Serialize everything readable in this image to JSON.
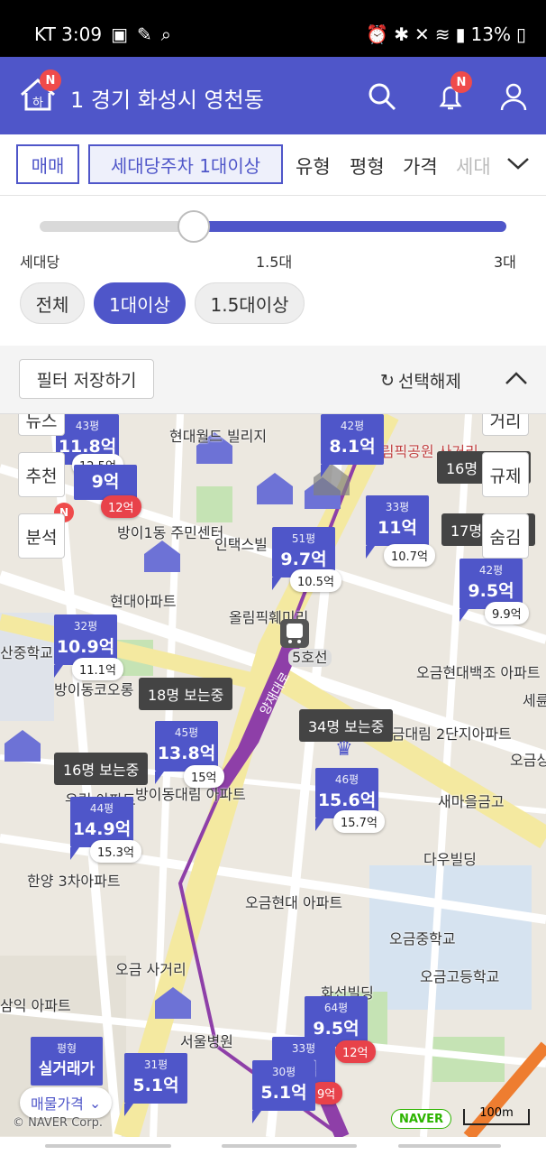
{
  "status": {
    "carrier_time": "KT 3:09",
    "battery": "13%"
  },
  "header": {
    "badge_home": "N",
    "location": "1  경기 화성시 영천동",
    "badge_bell": "N"
  },
  "filters": {
    "deal_type": "매매",
    "parking": "세대당주차 1대이상",
    "type": "유형",
    "size": "평형",
    "price": "가격",
    "more": "세대"
  },
  "slider": {
    "min_label": "세대당",
    "mid_label": "1.5대",
    "max_label": "3대",
    "value_fraction": 0.33,
    "options": [
      "전체",
      "1대이상",
      "1.5대이상"
    ],
    "selected": "1대이상"
  },
  "save_bar": {
    "save_label": "필터 저장하기",
    "reset_label": "선택해제"
  },
  "map": {
    "side_buttons": [
      "추천",
      "분석",
      "규제",
      "숨김"
    ],
    "side_top_partial": [
      "뉴스",
      "거리"
    ],
    "recommend_badge": "N",
    "labels": [
      "현대월드 빌리지",
      "방이1동 주민센터",
      "인택스빌 아파트",
      "현대아파트",
      "올림픽훼미리",
      "오금현대백조 아파트",
      "방이동코오롱 아파트",
      "오금대림 2단지아파트",
      "새마을금고",
      "방이동대림 아파트",
      "우림 아파트",
      "한양 3차아파트",
      "다우빌딩",
      "오금현대 아파트",
      "오금중학교",
      "오금고등학교",
      "오금 사거리",
      "화선빌딩",
      "서울병원",
      "산중학교",
      "삼익 아파트",
      "올림픽공원 사거리",
      "세륜",
      "오금상"
    ],
    "station": "5호선",
    "road_label": "양재대로",
    "viewers": [
      "18명 보는중",
      "34명 보는중",
      "16명 보는중",
      "16명 보는중",
      "17명 보는중"
    ],
    "markers": [
      {
        "pyeong": "43평",
        "price": "11.8억",
        "sub": "12.5억"
      },
      {
        "pyeong": "",
        "price": "9억",
        "sub": "12억"
      },
      {
        "pyeong": "42평",
        "price": "8.1억",
        "sub": ""
      },
      {
        "pyeong": "51평",
        "price": "9.7억",
        "sub": "10.5억"
      },
      {
        "pyeong": "33평",
        "price": "11억",
        "sub": "10.7억"
      },
      {
        "pyeong": "42평",
        "price": "9.5억",
        "sub": "9.9억"
      },
      {
        "pyeong": "32평",
        "price": "10.9억",
        "sub": "11.1억"
      },
      {
        "pyeong": "45평",
        "price": "13.8억",
        "sub": "15억"
      },
      {
        "pyeong": "46평",
        "price": "15.6억",
        "sub": "15.7억"
      },
      {
        "pyeong": "44평",
        "price": "14.9억",
        "sub": "15.3억"
      },
      {
        "pyeong": "64평",
        "price": "9.5억",
        "sub": "12억"
      },
      {
        "pyeong": "33평",
        "price": "9억",
        "sub": "9억"
      },
      {
        "pyeong": "30평",
        "price": "5.1억",
        "sub": ""
      },
      {
        "pyeong": "31평",
        "price": "5.1억",
        "sub": ""
      },
      {
        "pyeong": "평형",
        "price": "실거래가",
        "sub": ""
      },
      {
        "pyeong": "31평",
        "price": "",
        "sub": ""
      }
    ],
    "bottom_toggle": "매물가격",
    "copyright": "© NAVER Corp.",
    "naver": "NAVER",
    "scale": "100m"
  },
  "colors": {
    "primary": "#4f56c9",
    "badge_red": "#ef4b4b",
    "subway_purple": "#8e3fa8",
    "road_yellow": "#f4e9a0",
    "green": "#c5e3b4"
  }
}
